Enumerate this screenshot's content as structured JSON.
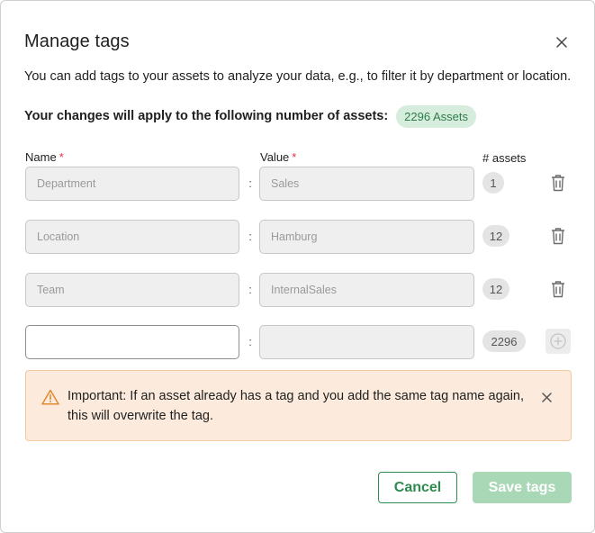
{
  "dialog": {
    "title": "Manage tags",
    "description": "You can add tags to your assets to analyze your data, e.g., to filter it by department or location.",
    "changes_label": "Your changes will apply to the following number of assets:",
    "asset_badge": "2296 Assets"
  },
  "columns": {
    "name_label": "Name",
    "value_label": "Value",
    "required_mark": "*",
    "assets_label": "# assets"
  },
  "separator": ":",
  "rows": [
    {
      "name_placeholder": "Department",
      "value_placeholder": "Sales",
      "count": "1"
    },
    {
      "name_placeholder": "Location",
      "value_placeholder": "Hamburg",
      "count": "12"
    },
    {
      "name_placeholder": "Team",
      "value_placeholder": "InternalSales",
      "count": "12"
    },
    {
      "name_placeholder": "",
      "value_placeholder": "",
      "count": "2296"
    }
  ],
  "alert": {
    "text": "Important: If an asset already has a tag and you add the same tag name again, this will overwrite the tag.",
    "icon": "warning-icon",
    "color": "#e08a2e"
  },
  "footer": {
    "cancel_label": "Cancel",
    "save_label": "Save tags"
  },
  "icons": {
    "close": "close-icon",
    "delete": "trash-icon",
    "add": "plus-circle-icon"
  },
  "colors": {
    "accent": "#2e8b4f",
    "badge_bg": "#d6ecdc",
    "alert_bg": "#fcebdc",
    "required": "#d9363e",
    "save_disabled": "#a9d8b7"
  }
}
